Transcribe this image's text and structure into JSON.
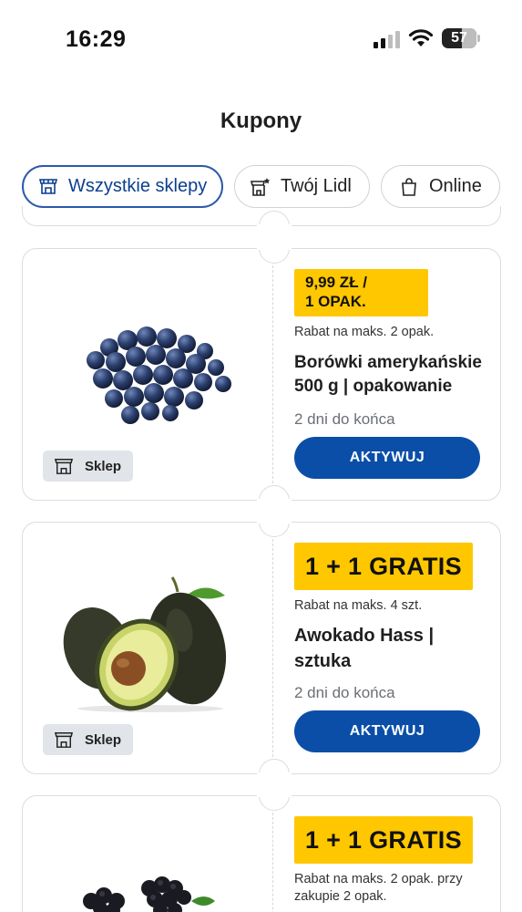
{
  "status_bar": {
    "time": "16:29",
    "battery": "57",
    "battery_level_pct": 57
  },
  "header": {
    "title": "Kupony"
  },
  "filters": [
    {
      "label": "Wszystkie sklepy",
      "icon": "store-icon",
      "active": true
    },
    {
      "label": "Twój Lidl",
      "icon": "store-star-icon",
      "active": false
    },
    {
      "label": "Online",
      "icon": "shopping-bag-icon",
      "active": false
    }
  ],
  "coupons": [
    {
      "price_line1": "9,99 ZŁ /",
      "price_line2": "1 OPAK.",
      "limit": "Rabat na maks. 2 opak.",
      "name": "Borówki amerykańskie 500 g | opakowanie",
      "days_left": "2 dni do końca",
      "button": "AKTYWUJ",
      "store_badge": "Sklep",
      "image": "blueberries"
    },
    {
      "price": "1 + 1 GRATIS",
      "limit": "Rabat na maks. 4 szt.",
      "name": "Awokado Hass | sztuka",
      "days_left": "2 dni do końca",
      "button": "AKTYWUJ",
      "store_badge": "Sklep",
      "image": "avocado"
    },
    {
      "price": "1 + 1 GRATIS",
      "limit": "Rabat na maks. 2 opak. przy zakupie 2 opak.",
      "image": "blackberries"
    }
  ],
  "colors": {
    "accent_blue": "#0a4ea8",
    "price_yellow": "#ffc700",
    "badge_gray": "#e1e4e8"
  }
}
